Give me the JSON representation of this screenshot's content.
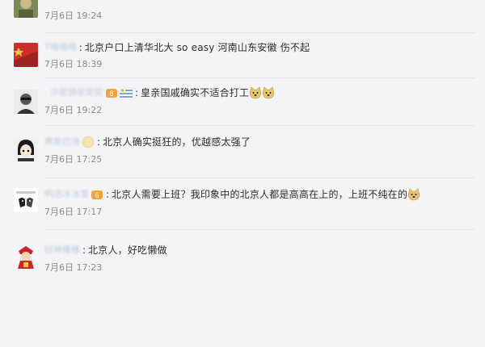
{
  "comments": [
    {
      "user": "",
      "text": "",
      "time": "7月6日 19:24"
    },
    {
      "user": "T嘀嘀嘀",
      "text": "北京户口上清华北大 so easy 河南山东安徽 伤不起",
      "time": "7月6日 18:39"
    },
    {
      "user": "· 沙驼骑驼驼驼",
      "text": "皇亲国戚确实不适合打工",
      "time": "7月6日 19:22"
    },
    {
      "user": "弗斯巴迪",
      "text": "北京人确实挺狂的，优越感太强了",
      "time": "7月6日 17:25"
    },
    {
      "user": "鸭迅冰冰雪",
      "text": "北京人需要上班？我印象中的北京人都是高高在上的，上班不纯在的",
      "time": "7月6日 17:17"
    },
    {
      "user": "好神棒棒",
      "text": "北京人，好吃懒做",
      "time": "7月6日 17:23"
    }
  ],
  "colors": {
    "background": "#f4f4f6",
    "username": "#5b87b6",
    "text": "#2b2b2b",
    "time": "#8a8a8a"
  },
  "icons": {
    "doge_emoji": "doge-emoji-icon",
    "smile_emoji": "smile-emoji-icon",
    "vip_badge": "vip-badge-icon",
    "flag_badge": "flag-badge-icon"
  }
}
